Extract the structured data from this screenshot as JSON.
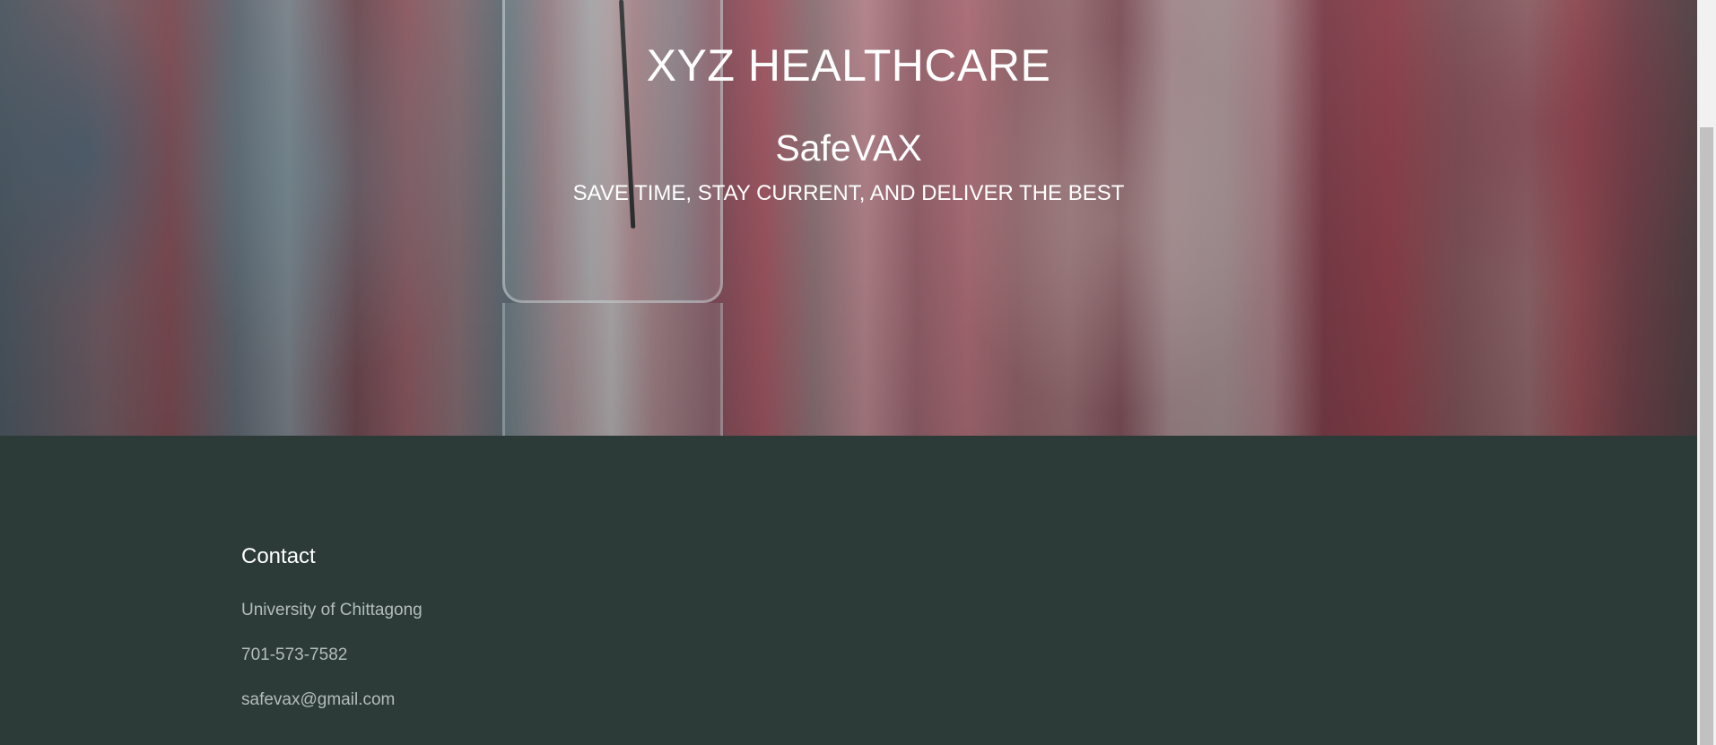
{
  "hero": {
    "organization": "XYZ HEALTHCARE",
    "product": "SafeVAX",
    "tagline": "SAVE TIME, STAY CURRENT, AND DELIVER THE BEST"
  },
  "footer": {
    "contact": {
      "heading": "Contact",
      "address": "University of Chittagong",
      "phone": "701-573-7582",
      "email": "safevax@gmail.com"
    }
  },
  "colors": {
    "footer_background": "#2c3a38",
    "footer_text": "#b3bdb9",
    "heading_text": "#ffffff"
  },
  "icons": {
    "hero_image": "vaccine-vial-photo"
  }
}
